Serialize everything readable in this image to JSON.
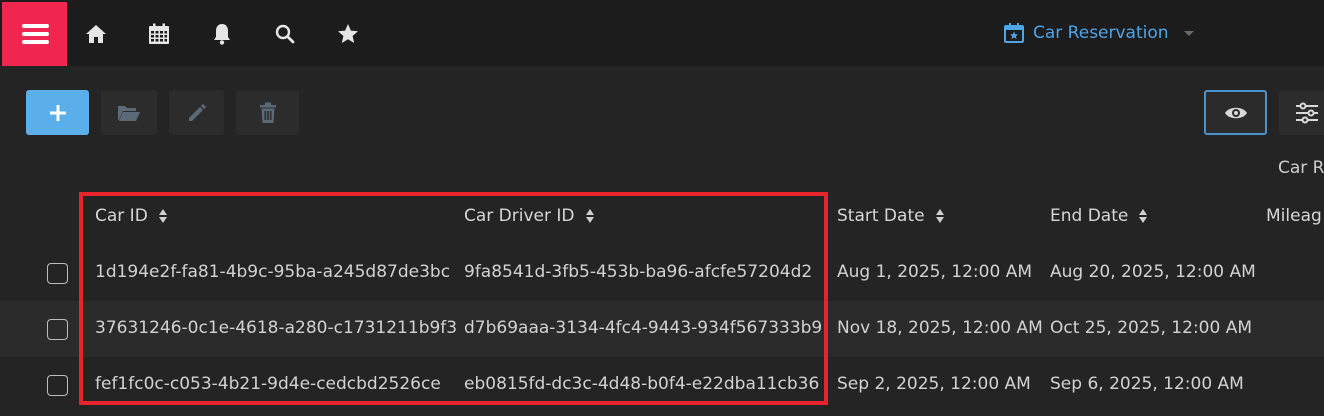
{
  "navbar": {
    "app_title": "Car Reservation",
    "icons": [
      "menu-icon",
      "home-icon",
      "calendar-icon",
      "bell-icon",
      "search-icon",
      "star-icon"
    ]
  },
  "toolbar": {
    "buttons": [
      "add-icon",
      "folder-open-icon",
      "pencil-icon",
      "trash-icon",
      "eye-icon",
      "sliders-icon"
    ]
  },
  "table": {
    "partial_group_label": "Car R",
    "columns": {
      "car_id": "Car ID",
      "car_driver_id": "Car Driver ID",
      "start_date": "Start Date",
      "end_date": "End Date",
      "mileage": "Mileag"
    },
    "rows": [
      {
        "car_id": "1d194e2f-fa81-4b9c-95ba-a245d87de3bc",
        "car_driver_id": "9fa8541d-3fb5-453b-ba96-afcfe57204d2",
        "start_date": "Aug 1, 2025, 12:00 AM",
        "end_date": "Aug 20, 2025, 12:00 AM"
      },
      {
        "car_id": "37631246-0c1e-4618-a280-c1731211b9f3",
        "car_driver_id": "d7b69aaa-3134-4fc4-9443-934f567333b9",
        "start_date": "Nov 18, 2025, 12:00 AM",
        "end_date": "Oct 25, 2025, 12:00 AM"
      },
      {
        "car_id": "fef1fc0c-c053-4b21-9d4e-cedcbd2526ce",
        "car_driver_id": "eb0815fd-dc3c-4d48-b0f4-e22dba11cb36",
        "start_date": "Sep 2, 2025, 12:00 AM",
        "end_date": "Sep 6, 2025, 12:00 AM"
      }
    ]
  },
  "colors": {
    "accent_pink": "#f0264f",
    "accent_blue": "#5aafea",
    "highlight_red": "#e8232b"
  }
}
